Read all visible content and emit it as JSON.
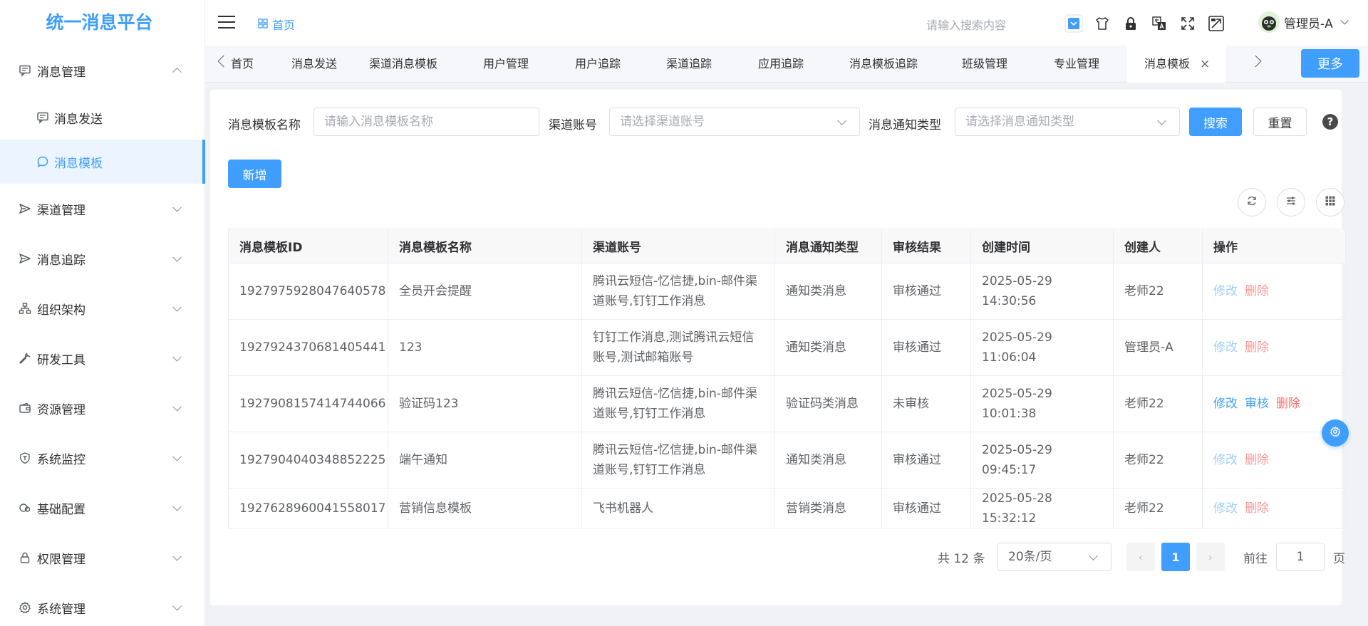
{
  "app": {
    "title": "统一消息平台"
  },
  "sidebar": {
    "message_mgmt": {
      "label": "消息管理",
      "icon": "message-square-icon"
    },
    "sub_send": {
      "label": "消息发送",
      "icon": "message-square-icon"
    },
    "sub_template": {
      "label": "消息模板",
      "icon": "chat-bubble-icon"
    },
    "items": [
      {
        "label": "渠道管理",
        "icon": "send-icon"
      },
      {
        "label": "消息追踪",
        "icon": "send-icon"
      },
      {
        "label": "组织架构",
        "icon": "org-tree-icon"
      },
      {
        "label": "研发工具",
        "icon": "wrench-icon"
      },
      {
        "label": "资源管理",
        "icon": "wallet-icon"
      },
      {
        "label": "系统监控",
        "icon": "shield-icon"
      },
      {
        "label": "基础配置",
        "icon": "link-circle-icon"
      },
      {
        "label": "权限管理",
        "icon": "lock-icon"
      },
      {
        "label": "系统管理",
        "icon": "gear-icon"
      }
    ]
  },
  "header": {
    "breadcrumb": "首页",
    "search_placeholder": "请输入搜索内容",
    "user_name": "管理员-A"
  },
  "tabs": {
    "items": [
      "首页",
      "消息发送",
      "渠道消息模板",
      "用户管理",
      "用户追踪",
      "渠道追踪",
      "应用追踪",
      "消息模板追踪",
      "班级管理",
      "专业管理"
    ],
    "active": "消息模板",
    "close": "×",
    "more": "更多"
  },
  "filters": {
    "name_label": "消息模板名称",
    "name_placeholder": "请输入消息模板名称",
    "channel_label": "渠道账号",
    "channel_placeholder": "请选择渠道账号",
    "type_label": "消息通知类型",
    "type_placeholder": "请选择消息通知类型",
    "search": "搜索",
    "reset": "重置",
    "help": "?"
  },
  "toolbar": {
    "add": "新增"
  },
  "table": {
    "headers": [
      "消息模板ID",
      "消息模板名称",
      "渠道账号",
      "消息通知类型",
      "审核结果",
      "创建时间",
      "创建人",
      "操作"
    ],
    "rows": [
      {
        "id": "1927975928047640578",
        "name": "全员开会提醒",
        "channel": "腾讯云短信-忆信捷,bin-邮件渠道账号,钉钉工作消息",
        "type": "通知类消息",
        "review": "审核通过",
        "time": "2025-05-29 14:30:56",
        "creator": "老师22",
        "edit": "修改",
        "del": "删除"
      },
      {
        "id": "1927924370681405441",
        "name": "123",
        "channel": "钉钉工作消息,测试腾讯云短信账号,测试邮箱账号",
        "type": "通知类消息",
        "review": "审核通过",
        "time": "2025-05-29 11:06:04",
        "creator": "管理员-A",
        "edit": "修改",
        "del": "删除"
      },
      {
        "id": "1927908157414744066",
        "name": "验证码123",
        "channel": "腾讯云短信-忆信捷,bin-邮件渠道账号,钉钉工作消息",
        "type": "验证码类消息",
        "review": "未审核",
        "time": "2025-05-29 10:01:38",
        "creator": "老师22",
        "edit": "修改",
        "audit": "审核",
        "del": "删除"
      },
      {
        "id": "1927904040348852225",
        "name": "端午通知",
        "channel": "腾讯云短信-忆信捷,bin-邮件渠道账号,钉钉工作消息",
        "type": "通知类消息",
        "review": "审核通过",
        "time": "2025-05-29 09:45:17",
        "creator": "老师22",
        "edit": "修改",
        "del": "删除"
      },
      {
        "id": "1927628960041558017",
        "name": "营销信息模板",
        "channel": "飞书机器人",
        "type": "营销类消息",
        "review": "审核通过",
        "time": "2025-05-28 15:32:12",
        "creator": "老师22",
        "edit": "修改",
        "del": "删除"
      }
    ]
  },
  "pagination": {
    "total": "共 12 条",
    "page_size": "20条/页",
    "prev": "‹",
    "current": "1",
    "next": "›",
    "goto_label": "前往",
    "goto_value": "1",
    "page_suffix": "页"
  },
  "colors": {
    "primary": "#409eff",
    "notice": "#e91e8c",
    "code": "#1a1aff",
    "success": "#1a8a1a",
    "danger": "#f56c6c"
  }
}
